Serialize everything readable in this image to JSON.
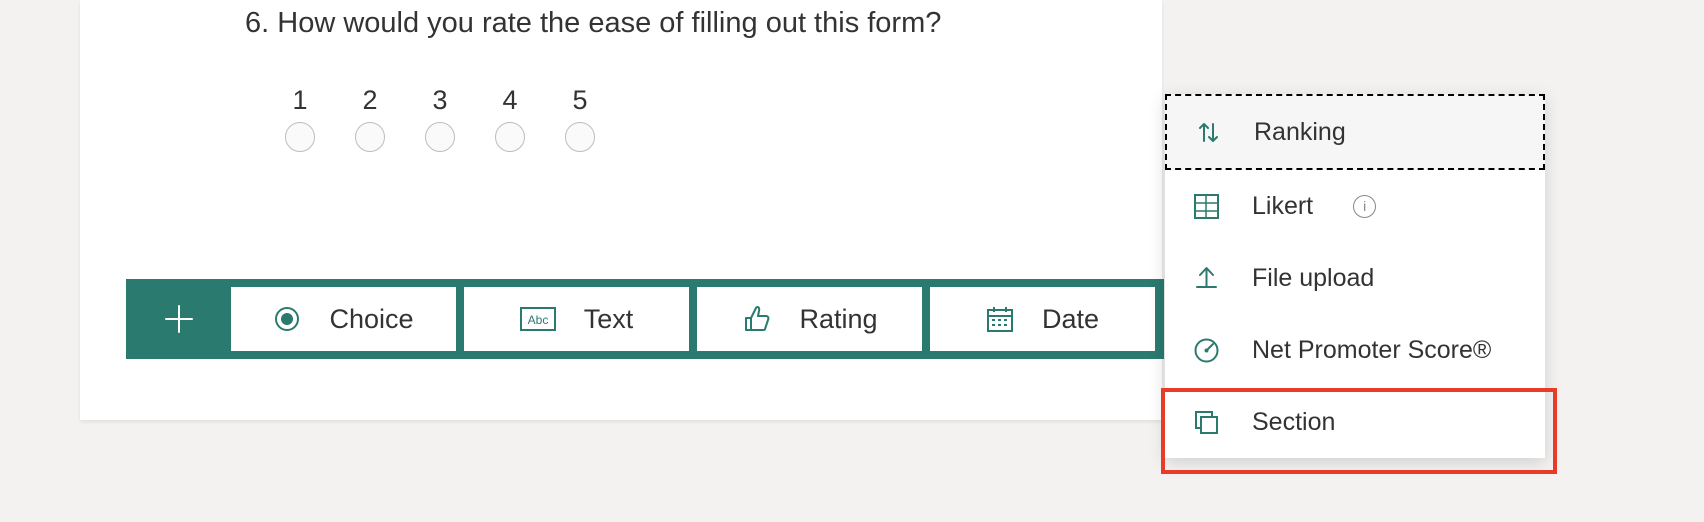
{
  "question": {
    "number": "6.",
    "text": "How would you rate the ease of filling out this form?",
    "scale": [
      "1",
      "2",
      "3",
      "4",
      "5"
    ]
  },
  "toolbar": {
    "choice_label": "Choice",
    "text_label": "Text",
    "rating_label": "Rating",
    "date_label": "Date"
  },
  "dropdown": {
    "ranking": "Ranking",
    "likert": "Likert",
    "file_upload": "File upload",
    "nps": "Net Promoter Score®",
    "section": "Section"
  },
  "colors": {
    "accent": "#2b7a6f",
    "highlight": "#e73c28"
  }
}
